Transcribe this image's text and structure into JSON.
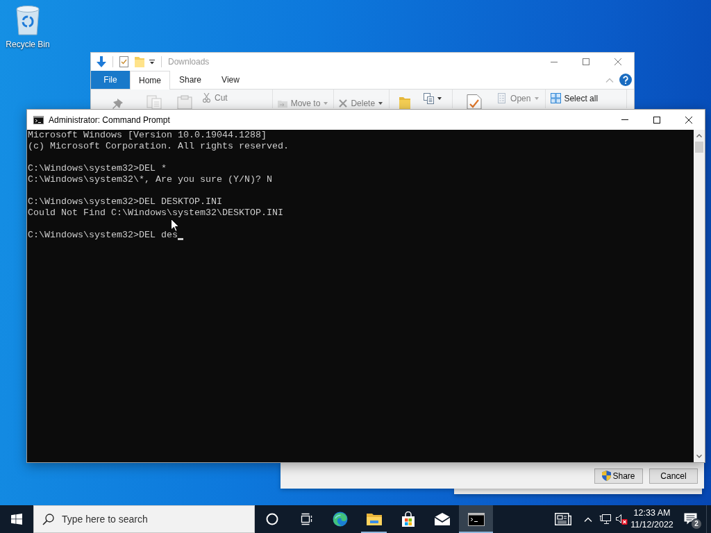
{
  "desktop_icons": [
    {
      "label": "Recycle Bin"
    }
  ],
  "explorer": {
    "title": "Downloads",
    "tabs": [
      {
        "label": "File",
        "kind": "file",
        "selected": false
      },
      {
        "label": "Home",
        "kind": "tab",
        "selected": true
      },
      {
        "label": "Share",
        "kind": "tab",
        "selected": false
      },
      {
        "label": "View",
        "kind": "tab",
        "selected": false
      }
    ],
    "ribbon": {
      "cut": {
        "label": "Cut",
        "disabled": true
      },
      "move_to": {
        "label": "Move to",
        "disabled": true
      },
      "delete": {
        "label": "Delete",
        "disabled": true
      },
      "open": {
        "label": "Open",
        "disabled": true
      },
      "select_all": {
        "label": "Select all",
        "disabled": false
      }
    }
  },
  "command_prompt": {
    "title": "Administrator: Command Prompt",
    "blocks": [
      [
        "Microsoft Windows [Version 10.0.19044.1288]",
        "(c) Microsoft Corporation. All rights reserved."
      ],
      [
        "C:\\Windows\\system32>DEL *",
        "C:\\Windows\\system32\\*, Are you sure (Y/N)? N"
      ],
      [
        "C:\\Windows\\system32>DEL DESKTOP.INI",
        "Could Not Find C:\\Windows\\system32\\DESKTOP.INI"
      ],
      [
        "C:\\Windows\\system32>DEL des"
      ]
    ],
    "cursor_visible": true
  },
  "dialog": {
    "buttons": [
      {
        "label": "Share",
        "kind": "elevated"
      },
      {
        "label": "Cancel",
        "kind": "plain"
      }
    ]
  },
  "taskbar": {
    "search": {
      "placeholder": "Type here to search"
    },
    "buttons": [
      {
        "kind": "cortana",
        "running": false,
        "selected": false
      },
      {
        "kind": "task_view",
        "running": false,
        "selected": false
      },
      {
        "kind": "edge",
        "running": false,
        "selected": false
      },
      {
        "kind": "file_explorer",
        "running": true,
        "selected": false
      },
      {
        "kind": "store",
        "running": false,
        "selected": false
      },
      {
        "kind": "mail",
        "running": false,
        "selected": false
      },
      {
        "kind": "command_prompt",
        "running": true,
        "selected": true
      }
    ],
    "tray": {
      "volume_muted": true,
      "time": "12:33 AM",
      "date": "11/12/2022",
      "notification_count": "2"
    }
  }
}
